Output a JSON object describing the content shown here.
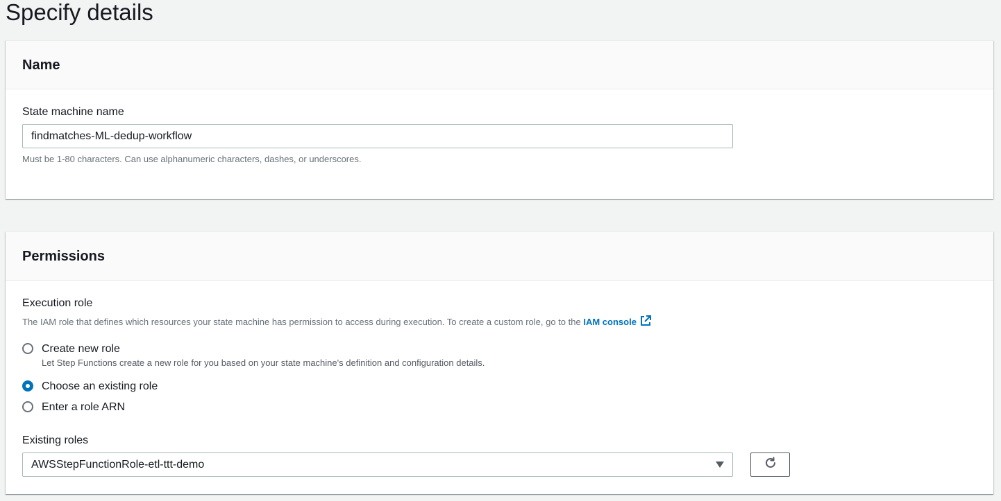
{
  "page": {
    "title": "Specify details"
  },
  "name_panel": {
    "header": "Name",
    "field_label": "State machine name",
    "field_value": "findmatches-ML-dedup-workflow",
    "field_hint": "Must be 1-80 characters. Can use alphanumeric characters, dashes, or underscores."
  },
  "permissions_panel": {
    "header": "Permissions",
    "execution_role_label": "Execution role",
    "execution_role_desc": "The IAM role that defines which resources your state machine has permission to access during execution. To create a custom role, go to the",
    "iam_link_label": "IAM console",
    "external_link_icon": "external-link-icon",
    "options": [
      {
        "label": "Create new role",
        "description": "Let Step Functions create a new role for you based on your state machine's definition and configuration details.",
        "selected": false
      },
      {
        "label": "Choose an existing role",
        "selected": true
      },
      {
        "label": "Enter a role ARN",
        "selected": false
      }
    ],
    "existing_roles_label": "Existing roles",
    "existing_roles_value": "AWSStepFunctionRole-etl-ttt-demo",
    "refresh_icon": "refresh-icon"
  },
  "colors": {
    "accent": "#0073bb",
    "background": "#f2f3f3",
    "panel_header": "#fafafa",
    "text": "#16191f",
    "muted_text": "#687078"
  }
}
